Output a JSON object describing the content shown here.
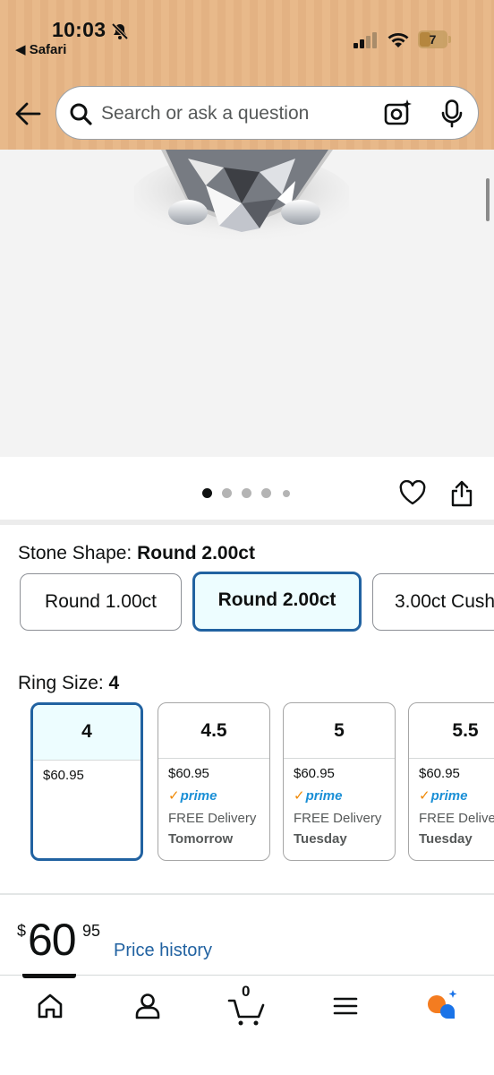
{
  "status_bar": {
    "time": "10:03",
    "back_app": "◀ Safari",
    "battery": "7"
  },
  "search": {
    "placeholder": "Search or ask a question"
  },
  "gallery": {
    "dots_count": 5,
    "active_dot": 0
  },
  "stone_shape": {
    "label": "Stone Shape: ",
    "selected": "Round 2.00ct",
    "options": [
      "Round 1.00ct",
      "Round 2.00ct",
      "3.00ct Cush"
    ]
  },
  "ring_size": {
    "label": "Ring Size: ",
    "selected": "4",
    "options": [
      {
        "size": "4",
        "price": "$60.95",
        "prime": "",
        "delivery": "",
        "day": ""
      },
      {
        "size": "4.5",
        "price": "$60.95",
        "prime": "prime",
        "delivery": "FREE Delivery",
        "day": "Tomorrow"
      },
      {
        "size": "5",
        "price": "$60.95",
        "prime": "prime",
        "delivery": "FREE Delivery",
        "day": "Tuesday"
      },
      {
        "size": "5.5",
        "price": "$60.95",
        "prime": "prime",
        "delivery": "FREE Delivery",
        "day": "Tuesday"
      }
    ]
  },
  "price": {
    "symbol": "$",
    "whole": "60",
    "fraction": "95",
    "history_link": "Price history"
  },
  "bottom_nav": {
    "cart_count": "0",
    "items": [
      "home-icon",
      "account-icon",
      "cart-icon",
      "menu-icon",
      "rufus-icon"
    ]
  },
  "colors": {
    "header_bg": "#e8b98a",
    "selected_border": "#2162a1",
    "selected_bg": "#edfdff",
    "link": "#2162a1",
    "prime_blue": "#1a8fd6",
    "prime_check": "#f08804"
  }
}
